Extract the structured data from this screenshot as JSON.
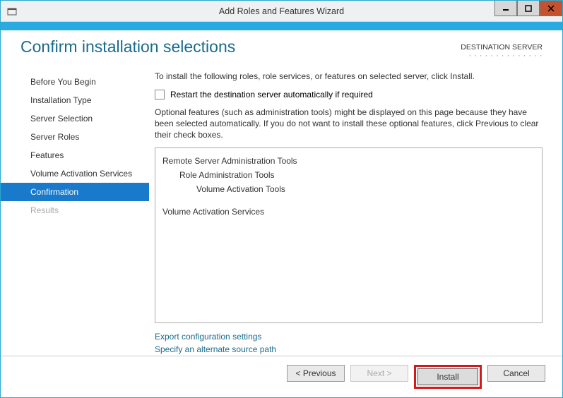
{
  "window": {
    "title": "Add Roles and Features Wizard"
  },
  "destination": {
    "label": "DESTINATION SERVER",
    "server": "· · · · · · · · · · · · · ·"
  },
  "heading": "Confirm installation selections",
  "sidebar": {
    "steps": [
      {
        "label": "Before You Begin"
      },
      {
        "label": "Installation Type"
      },
      {
        "label": "Server Selection"
      },
      {
        "label": "Server Roles"
      },
      {
        "label": "Features"
      },
      {
        "label": "Volume Activation Services"
      },
      {
        "label": "Confirmation"
      },
      {
        "label": "Results"
      }
    ]
  },
  "main": {
    "intro": "To install the following roles, role services, or features on selected server, click Install.",
    "restart_label": "Restart the destination server automatically if required",
    "optional_note": "Optional features (such as administration tools) might be displayed on this page because they have been selected automatically. If you do not want to install these optional features, click Previous to clear their check boxes.",
    "tree": {
      "n0": "Remote Server Administration Tools",
      "n1": "Role Administration Tools",
      "n2": "Volume Activation Tools",
      "g2": "Volume Activation Services"
    },
    "links": {
      "export": "Export configuration settings",
      "alt_source": "Specify an alternate source path"
    }
  },
  "buttons": {
    "previous": "< Previous",
    "next": "Next >",
    "install": "Install",
    "cancel": "Cancel"
  }
}
